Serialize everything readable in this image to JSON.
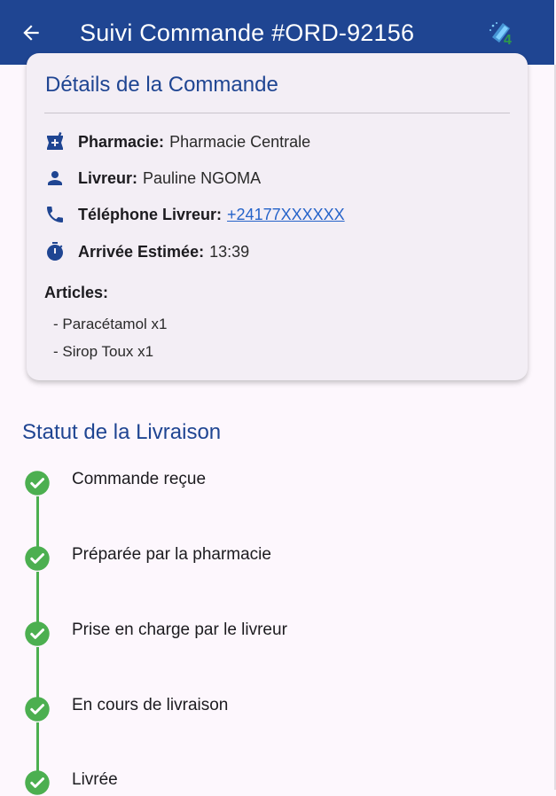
{
  "appbar": {
    "title": "Suivi Commande #ORD-92156",
    "back_icon": "arrow-left-icon",
    "logo_icon": "app-logo-icon",
    "background": "#1f4592"
  },
  "details": {
    "title": "Détails de la Commande",
    "rows": [
      {
        "icon": "pharmacy-icon",
        "label": "Pharmacie:",
        "value": "Pharmacie Centrale"
      },
      {
        "icon": "person-icon",
        "label": "Livreur:",
        "value": "Pauline NGOMA"
      },
      {
        "icon": "phone-icon",
        "label": "Téléphone Livreur:",
        "value": "+24177XXXXXX"
      },
      {
        "icon": "timer-icon",
        "label": "Arrivée Estimée:",
        "value": "13:39"
      }
    ],
    "articles_label": "Articles:",
    "articles": [
      "- Paracétamol x1",
      "- Sirop Toux x1"
    ]
  },
  "status": {
    "title": "Statut de la Livraison",
    "accent": "#4caf50",
    "steps": [
      {
        "label": "Commande reçue",
        "done": true
      },
      {
        "label": "Préparée par la pharmacie",
        "done": true
      },
      {
        "label": "Prise en charge par le livreur",
        "done": true
      },
      {
        "label": "En cours de livraison",
        "done": true
      },
      {
        "label": "Livrée",
        "done": true
      }
    ]
  }
}
